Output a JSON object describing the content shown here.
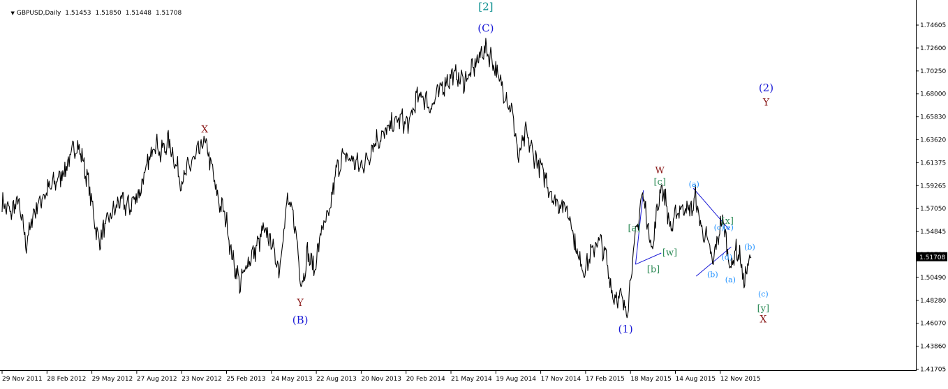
{
  "header": {
    "symbol_timeframe": "GBPUSD,Daily",
    "open": "1.51453",
    "high": "1.51850",
    "low": "1.51448",
    "close": "1.51708",
    "menu_icon": "triangle-down-icon"
  },
  "chart_data": {
    "type": "line",
    "title": "",
    "symbol": "GBPUSD",
    "timeframe": "Daily",
    "current_price": "1.51708",
    "ylim": [
      1.4077,
      1.7652
    ],
    "y_ticks": [
      "1.74605",
      "1.72600",
      "1.70250",
      "1.68000",
      "1.65830",
      "1.63620",
      "1.61375",
      "1.59265",
      "1.57050",
      "1.54845",
      "1.52700",
      "1.50490",
      "1.48280",
      "1.46070",
      "1.43860",
      "1.41705"
    ],
    "x_ticks": [
      "29 Nov 2011",
      "28 Feb 2012",
      "29 May 2012",
      "27 Aug 2012",
      "23 Nov 2012",
      "25 Feb 2013",
      "24 May 2013",
      "22 Aug 2013",
      "20 Nov 2013",
      "20 Feb 2014",
      "21 May 2014",
      "19 Aug 2014",
      "17 Nov 2014",
      "17 Feb 2015",
      "18 May 2015",
      "14 Aug 2015",
      "12 Nov 2015"
    ],
    "grid": false,
    "series": [
      {
        "values": [
          {
            "d": 0,
            "p": 1.57
          },
          {
            "d": 12,
            "p": 1.56
          },
          {
            "d": 22,
            "p": 1.572
          },
          {
            "d": 34,
            "p": 1.53
          },
          {
            "d": 45,
            "p": 1.562
          },
          {
            "d": 58,
            "p": 1.577
          },
          {
            "d": 72,
            "p": 1.588
          },
          {
            "d": 84,
            "p": 1.598
          },
          {
            "d": 95,
            "p": 1.612
          },
          {
            "d": 104,
            "p": 1.628
          },
          {
            "d": 112,
            "p": 1.615
          },
          {
            "d": 122,
            "p": 1.585
          },
          {
            "d": 135,
            "p": 1.532
          },
          {
            "d": 150,
            "p": 1.555
          },
          {
            "d": 165,
            "p": 1.571
          },
          {
            "d": 178,
            "p": 1.566
          },
          {
            "d": 192,
            "p": 1.58
          },
          {
            "d": 204,
            "p": 1.605
          },
          {
            "d": 214,
            "p": 1.632
          },
          {
            "d": 222,
            "p": 1.618
          },
          {
            "d": 234,
            "p": 1.63
          },
          {
            "d": 244,
            "p": 1.606
          },
          {
            "d": 252,
            "p": 1.59
          },
          {
            "d": 262,
            "p": 1.605
          },
          {
            "d": 272,
            "p": 1.615
          },
          {
            "d": 284,
            "p": 1.63
          },
          {
            "d": 292,
            "p": 1.61
          },
          {
            "d": 302,
            "p": 1.575
          },
          {
            "d": 314,
            "p": 1.555
          },
          {
            "d": 322,
            "p": 1.518
          },
          {
            "d": 334,
            "p": 1.49
          },
          {
            "d": 344,
            "p": 1.512
          },
          {
            "d": 356,
            "p": 1.525
          },
          {
            "d": 366,
            "p": 1.542
          },
          {
            "d": 376,
            "p": 1.535
          },
          {
            "d": 388,
            "p": 1.505
          },
          {
            "d": 400,
            "p": 1.572
          },
          {
            "d": 410,
            "p": 1.552
          },
          {
            "d": 420,
            "p": 1.489
          },
          {
            "d": 428,
            "p": 1.521
          },
          {
            "d": 438,
            "p": 1.505
          },
          {
            "d": 448,
            "p": 1.545
          },
          {
            "d": 458,
            "p": 1.555
          },
          {
            "d": 468,
            "p": 1.6
          },
          {
            "d": 478,
            "p": 1.615
          },
          {
            "d": 490,
            "p": 1.612
          },
          {
            "d": 502,
            "p": 1.605
          },
          {
            "d": 512,
            "p": 1.612
          },
          {
            "d": 522,
            "p": 1.63
          },
          {
            "d": 534,
            "p": 1.635
          },
          {
            "d": 546,
            "p": 1.645
          },
          {
            "d": 558,
            "p": 1.652
          },
          {
            "d": 570,
            "p": 1.645
          },
          {
            "d": 580,
            "p": 1.67
          },
          {
            "d": 590,
            "p": 1.675
          },
          {
            "d": 600,
            "p": 1.662
          },
          {
            "d": 610,
            "p": 1.675
          },
          {
            "d": 622,
            "p": 1.688
          },
          {
            "d": 634,
            "p": 1.695
          },
          {
            "d": 646,
            "p": 1.688
          },
          {
            "d": 656,
            "p": 1.695
          },
          {
            "d": 666,
            "p": 1.708
          },
          {
            "d": 676,
            "p": 1.72
          },
          {
            "d": 686,
            "p": 1.712
          },
          {
            "d": 696,
            "p": 1.69
          },
          {
            "d": 706,
            "p": 1.675
          },
          {
            "d": 716,
            "p": 1.655
          },
          {
            "d": 724,
            "p": 1.612
          },
          {
            "d": 734,
            "p": 1.638
          },
          {
            "d": 744,
            "p": 1.618
          },
          {
            "d": 754,
            "p": 1.605
          },
          {
            "d": 764,
            "p": 1.59
          },
          {
            "d": 774,
            "p": 1.572
          },
          {
            "d": 786,
            "p": 1.568
          },
          {
            "d": 796,
            "p": 1.558
          },
          {
            "d": 806,
            "p": 1.52
          },
          {
            "d": 816,
            "p": 1.505
          },
          {
            "d": 826,
            "p": 1.52
          },
          {
            "d": 836,
            "p": 1.535
          },
          {
            "d": 846,
            "p": 1.518
          },
          {
            "d": 856,
            "p": 1.48
          },
          {
            "d": 866,
            "p": 1.478
          },
          {
            "d": 876,
            "p": 1.465
          },
          {
            "d": 884,
            "p": 1.515
          },
          {
            "d": 892,
            "p": 1.555
          },
          {
            "d": 898,
            "p": 1.58
          },
          {
            "d": 904,
            "p": 1.552
          },
          {
            "d": 912,
            "p": 1.525
          },
          {
            "d": 918,
            "p": 1.562
          },
          {
            "d": 924,
            "p": 1.587
          },
          {
            "d": 930,
            "p": 1.572
          },
          {
            "d": 938,
            "p": 1.542
          },
          {
            "d": 946,
            "p": 1.562
          },
          {
            "d": 956,
            "p": 1.566
          },
          {
            "d": 966,
            "p": 1.562
          },
          {
            "d": 972,
            "p": 1.575
          },
          {
            "d": 980,
            "p": 1.545
          },
          {
            "d": 988,
            "p": 1.535
          },
          {
            "d": 996,
            "p": 1.51
          },
          {
            "d": 1004,
            "p": 1.538
          },
          {
            "d": 1010,
            "p": 1.555
          },
          {
            "d": 1016,
            "p": 1.528
          },
          {
            "d": 1022,
            "p": 1.505
          },
          {
            "d": 1028,
            "p": 1.525
          },
          {
            "d": 1034,
            "p": 1.518
          },
          {
            "d": 1040,
            "p": 1.492
          },
          {
            "d": 1046,
            "p": 1.51
          },
          {
            "d": 1050,
            "p": 1.517
          }
        ]
      }
    ],
    "annotations": [
      {
        "text": "[2]",
        "d": 678,
        "p": 1.7575,
        "color": "#008b8b",
        "size": 15
      },
      {
        "text": "(C)",
        "d": 678,
        "p": 1.7365,
        "color": "#1a1ad6",
        "size": 15
      },
      {
        "text": "X",
        "d": 284,
        "p": 1.6385,
        "color": "#8b1a1a",
        "size": 14
      },
      {
        "text": "Y",
        "d": 418,
        "p": 1.4695,
        "color": "#8b1a1a",
        "size": 14
      },
      {
        "text": "(B)",
        "d": 418,
        "p": 1.4525,
        "color": "#1a1ad6",
        "size": 15
      },
      {
        "text": "(1)",
        "d": 874,
        "p": 1.4435,
        "color": "#1a1ad6",
        "size": 15
      },
      {
        "text": "W",
        "d": 922,
        "p": 1.5985,
        "color": "#8b1a1a",
        "size": 13
      },
      {
        "text": "[c]",
        "d": 922,
        "p": 1.5875,
        "color": "#2e8b57",
        "size": 13
      },
      {
        "text": "[a]",
        "d": 886,
        "p": 1.5425,
        "color": "#2e8b57",
        "size": 13
      },
      {
        "text": "[b]",
        "d": 913,
        "p": 1.5025,
        "color": "#2e8b57",
        "size": 13
      },
      {
        "text": "[w]",
        "d": 936,
        "p": 1.5185,
        "color": "#2e8b57",
        "size": 13
      },
      {
        "text": "[x]",
        "d": 1017,
        "p": 1.5495,
        "color": "#2e8b57",
        "size": 13
      },
      {
        "text": "(a)",
        "d": 970,
        "p": 1.5855,
        "color": "#1e90ff",
        "size": 11
      },
      {
        "text": "(c)",
        "d": 1005,
        "p": 1.5435,
        "color": "#1e90ff",
        "size": 11
      },
      {
        "text": "(e)",
        "d": 1018,
        "p": 1.5435,
        "color": "#1e90ff",
        "size": 11
      },
      {
        "text": "(b)",
        "d": 996,
        "p": 1.4975,
        "color": "#1e90ff",
        "size": 11
      },
      {
        "text": "(d)",
        "d": 1016,
        "p": 1.5145,
        "color": "#1e90ff",
        "size": 11
      },
      {
        "text": "(a)",
        "d": 1021,
        "p": 1.4925,
        "color": "#1e90ff",
        "size": 11
      },
      {
        "text": "(b)",
        "d": 1048,
        "p": 1.5245,
        "color": "#1e90ff",
        "size": 11
      },
      {
        "text": "(c)",
        "d": 1067,
        "p": 1.4785,
        "color": "#1e90ff",
        "size": 11
      },
      {
        "text": "[y]",
        "d": 1067,
        "p": 1.4645,
        "color": "#2e8b57",
        "size": 13
      },
      {
        "text": "X",
        "d": 1067,
        "p": 1.4535,
        "color": "#8b1a1a",
        "size": 14
      },
      {
        "text": "(2)",
        "d": 1071,
        "p": 1.6785,
        "color": "#1a1ad6",
        "size": 15
      },
      {
        "text": "Y",
        "d": 1071,
        "p": 1.6645,
        "color": "#8b1a1a",
        "size": 14
      }
    ],
    "trendlines": [
      {
        "d1": 888,
        "p1": 1.51,
        "d2": 899,
        "p2": 1.582,
        "color": "#1a1ad6"
      },
      {
        "d1": 888,
        "p1": 1.51,
        "d2": 924,
        "p2": 1.521,
        "color": "#1a1ad6"
      },
      {
        "d1": 969,
        "p1": 1.584,
        "d2": 1019,
        "p2": 1.544,
        "color": "#1a1ad6"
      },
      {
        "d1": 973,
        "p1": 1.4985,
        "d2": 1022,
        "p2": 1.527,
        "color": "#1a1ad6"
      }
    ]
  }
}
